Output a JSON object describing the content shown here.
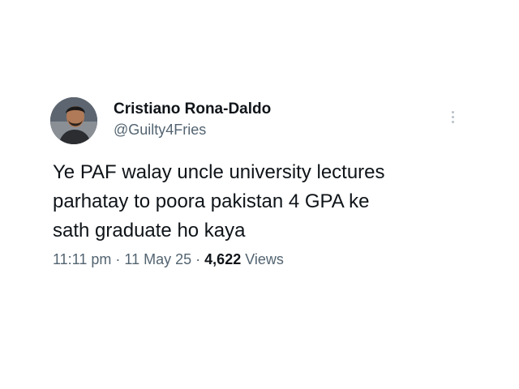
{
  "tweet": {
    "author": {
      "name": "Cristiano Rona-Daldo",
      "handle": "@Guilty4Fries"
    },
    "text": "Ye PAF walay uncle university lectures\nparhatay to poora pakistan 4 GPA ke\nsath graduate ho kaya",
    "time": "11:11 pm",
    "separator": "·",
    "date": "11 May 25",
    "views_count": "4,622",
    "views_label": "Views",
    "more_icon": "more-vertical-icon"
  }
}
